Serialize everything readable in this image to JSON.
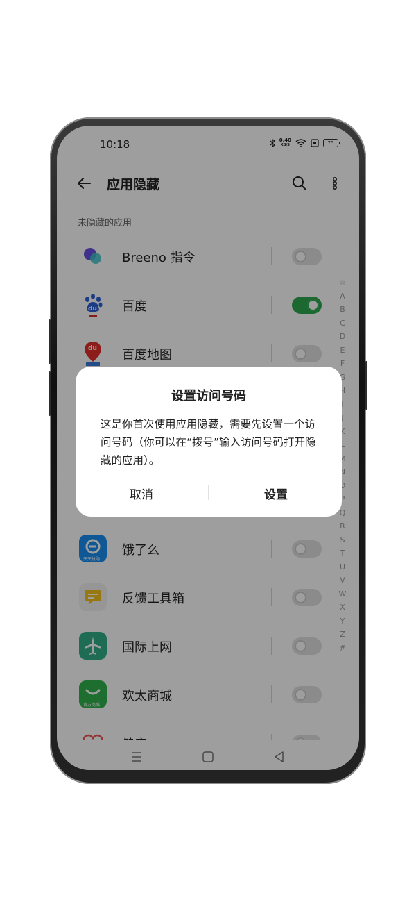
{
  "status_bar": {
    "time": "10:18",
    "net_speed_value": "0.40",
    "net_speed_unit": "KB/S",
    "battery": "75"
  },
  "app_bar": {
    "title": "应用隐藏"
  },
  "section_label": "未隐藏的应用",
  "apps": [
    {
      "label": "Breeno 指令",
      "toggle_on": false,
      "icon": "breeno-icon"
    },
    {
      "label": "百度",
      "toggle_on": true,
      "icon": "baidu-icon"
    },
    {
      "label": "百度地图",
      "toggle_on": false,
      "icon": "baidu-map-icon"
    },
    {
      "label": "饿了么",
      "toggle_on": false,
      "icon": "eleme-icon"
    },
    {
      "label": "反馈工具箱",
      "toggle_on": false,
      "icon": "feedback-toolbox-icon"
    },
    {
      "label": "国际上网",
      "toggle_on": false,
      "icon": "airplane-icon"
    },
    {
      "label": "欢太商城",
      "toggle_on": false,
      "icon": "heytap-store-icon"
    },
    {
      "label": "健康",
      "toggle_on": false,
      "icon": "health-icon"
    }
  ],
  "icon_text": {
    "baidu": "du",
    "baidu_map": "du",
    "eleme": "天天抢购",
    "heytap": "官方商城"
  },
  "alphabet_index": [
    "☆",
    "A",
    "B",
    "C",
    "D",
    "E",
    "F",
    "G",
    "H",
    "I",
    "J",
    "K",
    "L",
    "M",
    "N",
    "O",
    "P",
    "Q",
    "R",
    "S",
    "T",
    "U",
    "V",
    "W",
    "X",
    "Y",
    "Z",
    "#"
  ],
  "dialog": {
    "title": "设置访问号码",
    "body": "这是你首次使用应用隐藏，需要先设置一个访问号码（你可以在“拨号”输入访问号码打开隐藏的应用）。",
    "cancel_label": "取消",
    "confirm_label": "设置"
  },
  "colors": {
    "toggle_on": "#2ea84f",
    "dim_overlay": "rgba(0,0,0,0.38)"
  }
}
